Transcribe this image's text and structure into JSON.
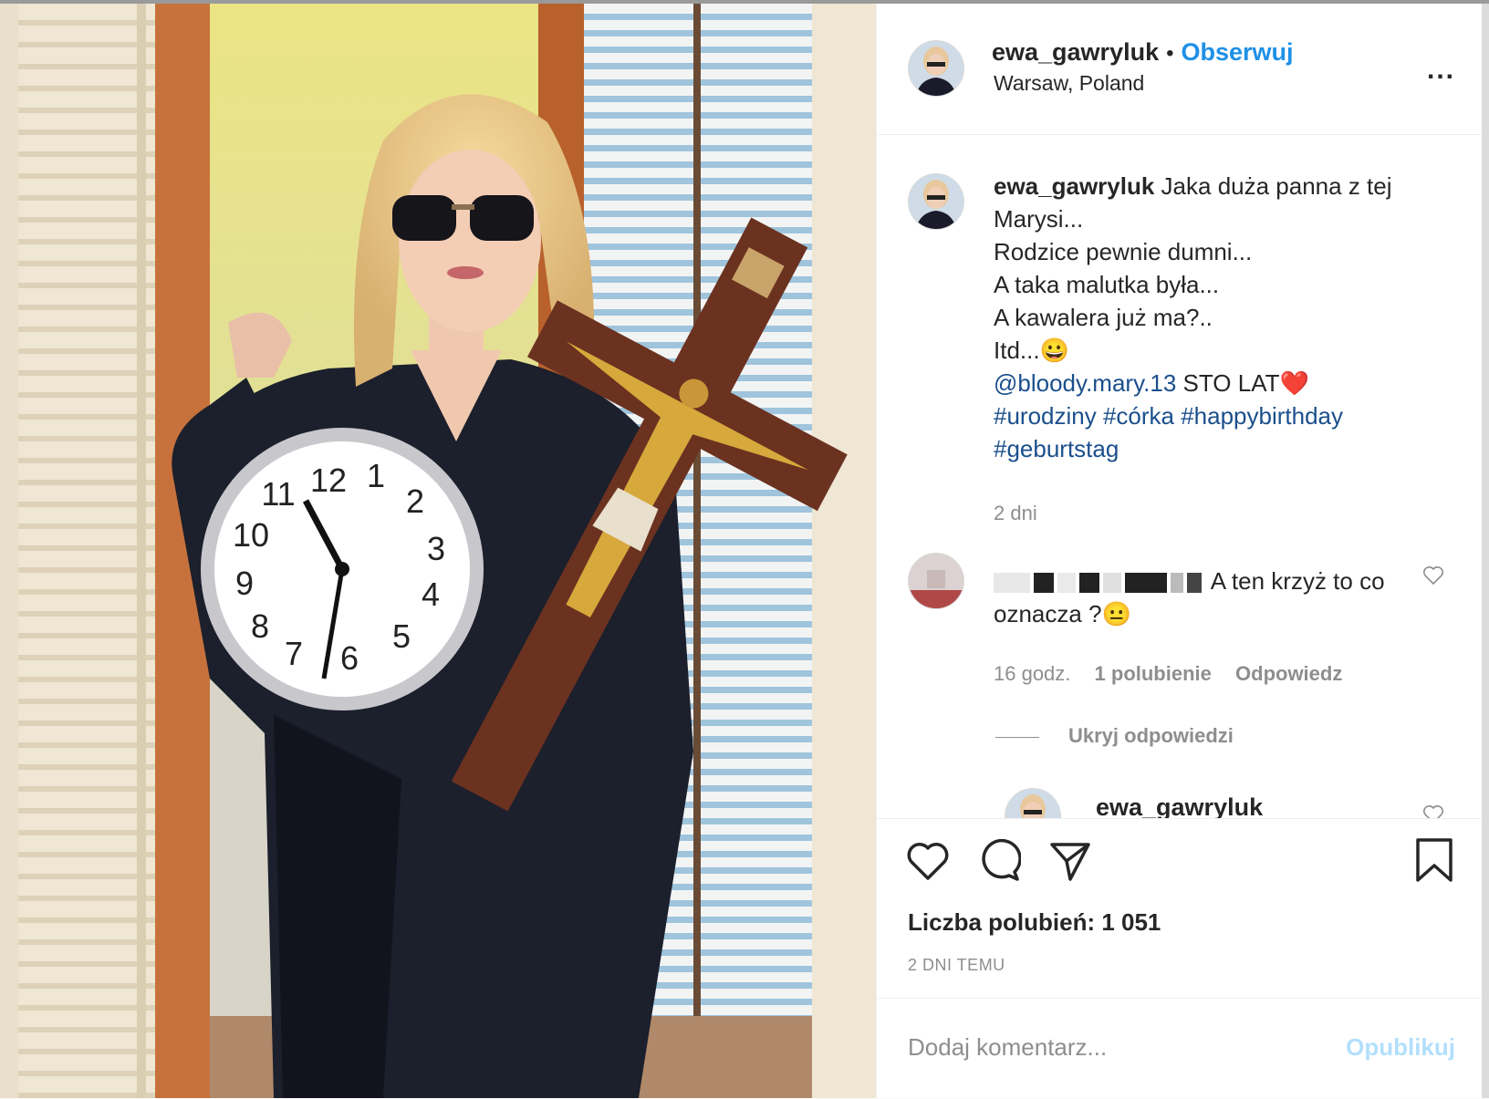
{
  "post": {
    "username": "ewa_gawryluk",
    "follow_label": "Obserwuj",
    "separator": "•",
    "location": "Warsaw, Poland",
    "more_label": "...",
    "caption_lines": [
      "Jaka duża panna z tej",
      "Marysi...",
      "Rodzice pewnie dumni...",
      "A taka malutka była...",
      "A kawalera już ma?..",
      "Itd...😀"
    ],
    "mention": "@bloody.mary.13",
    "mention_text": "STO LAT❤️",
    "hashtags_line1": "#urodziny #córka #happybirthday",
    "hashtags_line2": "#geburtstag",
    "caption_time": "2 dni",
    "comment": {
      "text_part1": "A ten krzyż to co",
      "text_part2": "oznacza ?😐",
      "time": "16 godz.",
      "likes": "1 polubienie",
      "reply_label": "Odpowiedz",
      "hide_replies_label": "Ukryj odpowiedzi"
    },
    "reply_username": "ewa_gawryluk",
    "likes_label": "Liczba polubień: 1 051",
    "date_label": "2 DNI TEMU",
    "comment_placeholder": "Dodaj komentarz...",
    "post_label": "Opublikuj"
  },
  "icons": {
    "like": "heart-icon",
    "comment": "comment-icon",
    "share": "share-icon",
    "save": "bookmark-icon"
  },
  "colors": {
    "follow": "#1e90e6",
    "hashtag": "#1b4f8c",
    "muted": "#8e8e8e"
  }
}
